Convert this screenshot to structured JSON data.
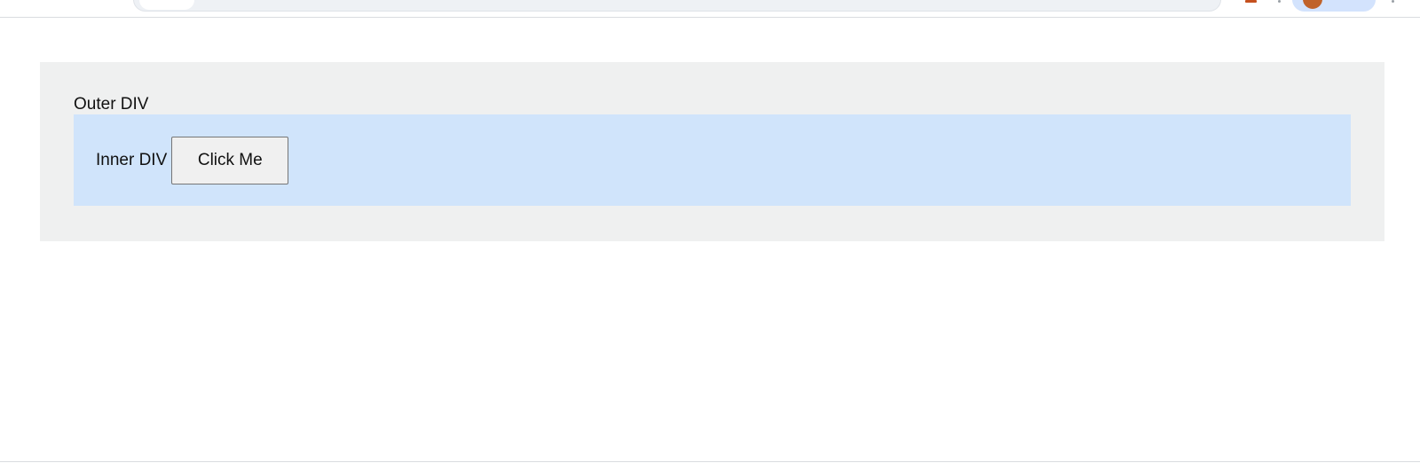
{
  "page": {
    "outer_label": "Outer DIV",
    "inner_label": "Inner DIV",
    "button_label": "Click Me"
  },
  "colors": {
    "outer_background": "#eff0f0",
    "inner_background": "#d0e4fb",
    "button_background": "#f0f0f0",
    "profile_pill": "#d3e3fd",
    "avatar": "#c0622a"
  },
  "icons": {
    "profile": "avatar-icon",
    "extension": "extension-icon"
  }
}
